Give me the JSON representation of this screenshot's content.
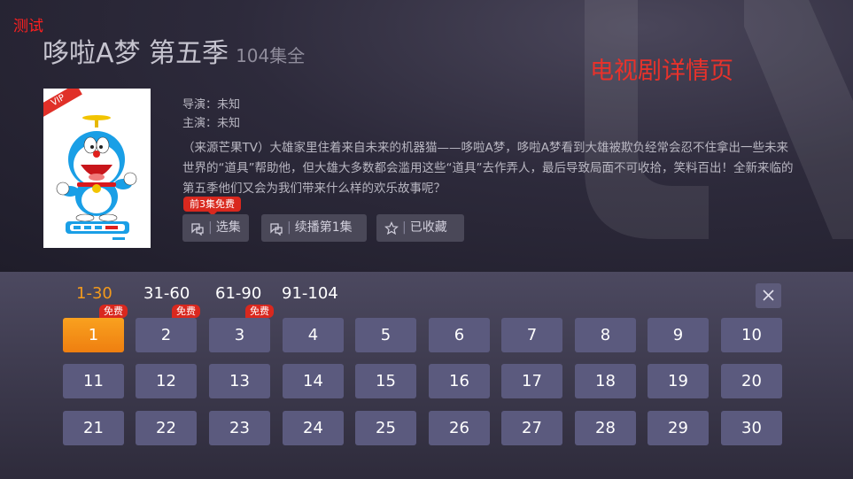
{
  "debug_label": "测试",
  "page_label": "电视剧详情页",
  "show": {
    "title": "哆啦A梦 第五季",
    "episode_count": "104集全",
    "director": "导演：未知",
    "cast": "主演：未知",
    "description": "（来源芒果TV）大雄家里住着来自未来的机器猫——哆啦A梦，哆啦A梦看到大雄被欺负经常会忍不住拿出一些未来世界的“道具”帮助他，但大雄大多数都会滥用这些“道具”去作弄人，最后导致局面不可收拾，笑料百出！全新来临的第五季他们又会为我们带来什么样的欢乐故事呢？",
    "poster_badge": "VIP"
  },
  "free_tip": "前3集免费",
  "actions": {
    "select_episode": "选集",
    "continue_play": "续播第1集",
    "favorited": "已收藏",
    "separator": "|"
  },
  "ranges": [
    "1-30",
    "31-60",
    "61-90",
    "91-104"
  ],
  "active_range": "1-30",
  "free_badge": "免费",
  "episodes": [
    "1",
    "2",
    "3",
    "4",
    "5",
    "6",
    "7",
    "8",
    "9",
    "10",
    "11",
    "12",
    "13",
    "14",
    "15",
    "16",
    "17",
    "18",
    "19",
    "20",
    "21",
    "22",
    "23",
    "24",
    "25",
    "26",
    "27",
    "28",
    "29",
    "30"
  ],
  "free_episodes": [
    1,
    2,
    3
  ],
  "active_episode": 1,
  "colors": {
    "accent": "#f39a1c",
    "badge_red": "#d9281e",
    "page_label_red": "#e8322b",
    "episode_bg": "#5b5a7e"
  }
}
